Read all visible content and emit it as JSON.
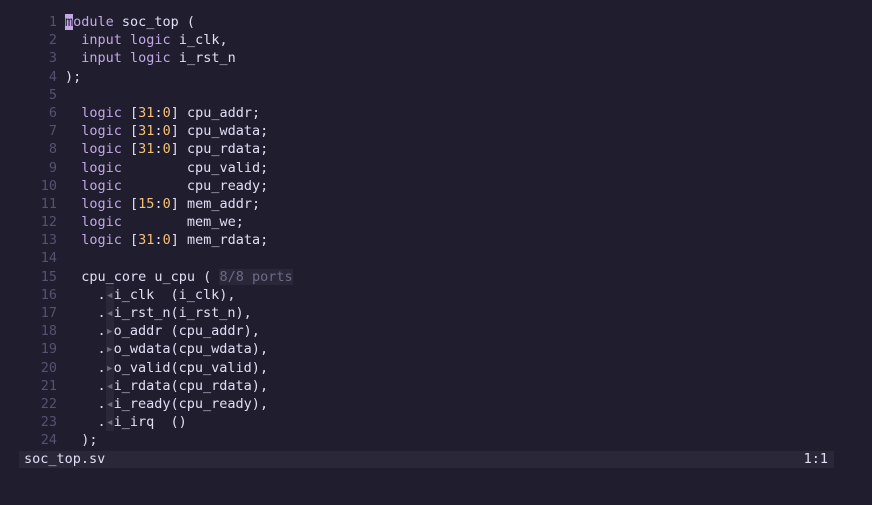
{
  "colors": {
    "background": "#1f1d2e",
    "keyword": "#c4a7e7",
    "number": "#f6c177",
    "text": "#e0def4",
    "gutter": "#565170",
    "inlay": "#6e6a86",
    "statusbar": "#2a2738"
  },
  "status": {
    "filename": "soc_top.sv",
    "position": "1:1"
  },
  "lines": [
    {
      "n": "1",
      "segs": [
        {
          "c": "cursor",
          "t": "m"
        },
        {
          "c": "kw",
          "t": "odule"
        },
        {
          "c": "id",
          "t": " soc_top ("
        }
      ]
    },
    {
      "n": "2",
      "segs": [
        {
          "c": "id",
          "t": "  "
        },
        {
          "c": "kw",
          "t": "input"
        },
        {
          "c": "id",
          "t": " "
        },
        {
          "c": "kw",
          "t": "logic"
        },
        {
          "c": "id",
          "t": " i_clk,"
        }
      ]
    },
    {
      "n": "3",
      "segs": [
        {
          "c": "id",
          "t": "  "
        },
        {
          "c": "kw",
          "t": "input"
        },
        {
          "c": "id",
          "t": " "
        },
        {
          "c": "kw",
          "t": "logic"
        },
        {
          "c": "id",
          "t": " i_rst_n"
        }
      ]
    },
    {
      "n": "4",
      "segs": [
        {
          "c": "id",
          "t": ");"
        }
      ]
    },
    {
      "n": "5",
      "segs": []
    },
    {
      "n": "6",
      "segs": [
        {
          "c": "id",
          "t": "  "
        },
        {
          "c": "kw",
          "t": "logic"
        },
        {
          "c": "id",
          "t": " ["
        },
        {
          "c": "num",
          "t": "31"
        },
        {
          "c": "id",
          "t": ":"
        },
        {
          "c": "num",
          "t": "0"
        },
        {
          "c": "id",
          "t": "] cpu_addr;"
        }
      ]
    },
    {
      "n": "7",
      "segs": [
        {
          "c": "id",
          "t": "  "
        },
        {
          "c": "kw",
          "t": "logic"
        },
        {
          "c": "id",
          "t": " ["
        },
        {
          "c": "num",
          "t": "31"
        },
        {
          "c": "id",
          "t": ":"
        },
        {
          "c": "num",
          "t": "0"
        },
        {
          "c": "id",
          "t": "] cpu_wdata;"
        }
      ]
    },
    {
      "n": "8",
      "segs": [
        {
          "c": "id",
          "t": "  "
        },
        {
          "c": "kw",
          "t": "logic"
        },
        {
          "c": "id",
          "t": " ["
        },
        {
          "c": "num",
          "t": "31"
        },
        {
          "c": "id",
          "t": ":"
        },
        {
          "c": "num",
          "t": "0"
        },
        {
          "c": "id",
          "t": "] cpu_rdata;"
        }
      ]
    },
    {
      "n": "9",
      "segs": [
        {
          "c": "id",
          "t": "  "
        },
        {
          "c": "kw",
          "t": "logic"
        },
        {
          "c": "id",
          "t": "        cpu_valid;"
        }
      ]
    },
    {
      "n": "10",
      "segs": [
        {
          "c": "id",
          "t": "  "
        },
        {
          "c": "kw",
          "t": "logic"
        },
        {
          "c": "id",
          "t": "        cpu_ready;"
        }
      ]
    },
    {
      "n": "11",
      "segs": [
        {
          "c": "id",
          "t": "  "
        },
        {
          "c": "kw",
          "t": "logic"
        },
        {
          "c": "id",
          "t": " ["
        },
        {
          "c": "num",
          "t": "15"
        },
        {
          "c": "id",
          "t": ":"
        },
        {
          "c": "num",
          "t": "0"
        },
        {
          "c": "id",
          "t": "] mem_addr;"
        }
      ]
    },
    {
      "n": "12",
      "segs": [
        {
          "c": "id",
          "t": "  "
        },
        {
          "c": "kw",
          "t": "logic"
        },
        {
          "c": "id",
          "t": "        mem_we;"
        }
      ]
    },
    {
      "n": "13",
      "segs": [
        {
          "c": "id",
          "t": "  "
        },
        {
          "c": "kw",
          "t": "logic"
        },
        {
          "c": "id",
          "t": " ["
        },
        {
          "c": "num",
          "t": "31"
        },
        {
          "c": "id",
          "t": ":"
        },
        {
          "c": "num",
          "t": "0"
        },
        {
          "c": "id",
          "t": "] mem_rdata;"
        }
      ]
    },
    {
      "n": "14",
      "segs": []
    },
    {
      "n": "15",
      "segs": [
        {
          "c": "id",
          "t": "  cpu_core u_cpu ( "
        },
        {
          "c": "virt",
          "t": "8/8 ports"
        }
      ]
    },
    {
      "n": "16",
      "segs": [
        {
          "c": "id",
          "t": "    ."
        },
        {
          "c": "arrow",
          "t": "◂"
        },
        {
          "c": "id",
          "t": "i_clk  (i_clk),"
        }
      ]
    },
    {
      "n": "17",
      "segs": [
        {
          "c": "id",
          "t": "    ."
        },
        {
          "c": "arrow",
          "t": "◂"
        },
        {
          "c": "id",
          "t": "i_rst_n(i_rst_n),"
        }
      ]
    },
    {
      "n": "18",
      "segs": [
        {
          "c": "id",
          "t": "    ."
        },
        {
          "c": "arrow",
          "t": "▸"
        },
        {
          "c": "id",
          "t": "o_addr (cpu_addr),"
        }
      ]
    },
    {
      "n": "19",
      "segs": [
        {
          "c": "id",
          "t": "    ."
        },
        {
          "c": "arrow",
          "t": "▸"
        },
        {
          "c": "id",
          "t": "o_wdata(cpu_wdata),"
        }
      ]
    },
    {
      "n": "20",
      "segs": [
        {
          "c": "id",
          "t": "    ."
        },
        {
          "c": "arrow",
          "t": "▸"
        },
        {
          "c": "id",
          "t": "o_valid(cpu_valid),"
        }
      ]
    },
    {
      "n": "21",
      "segs": [
        {
          "c": "id",
          "t": "    ."
        },
        {
          "c": "arrow",
          "t": "◂"
        },
        {
          "c": "id",
          "t": "i_rdata(cpu_rdata),"
        }
      ]
    },
    {
      "n": "22",
      "segs": [
        {
          "c": "id",
          "t": "    ."
        },
        {
          "c": "arrow",
          "t": "◂"
        },
        {
          "c": "id",
          "t": "i_ready(cpu_ready),"
        }
      ]
    },
    {
      "n": "23",
      "segs": [
        {
          "c": "id",
          "t": "    ."
        },
        {
          "c": "arrow",
          "t": "◂"
        },
        {
          "c": "id",
          "t": "i_irq  ()"
        }
      ]
    },
    {
      "n": "24",
      "segs": [
        {
          "c": "id",
          "t": "  );"
        }
      ]
    }
  ]
}
